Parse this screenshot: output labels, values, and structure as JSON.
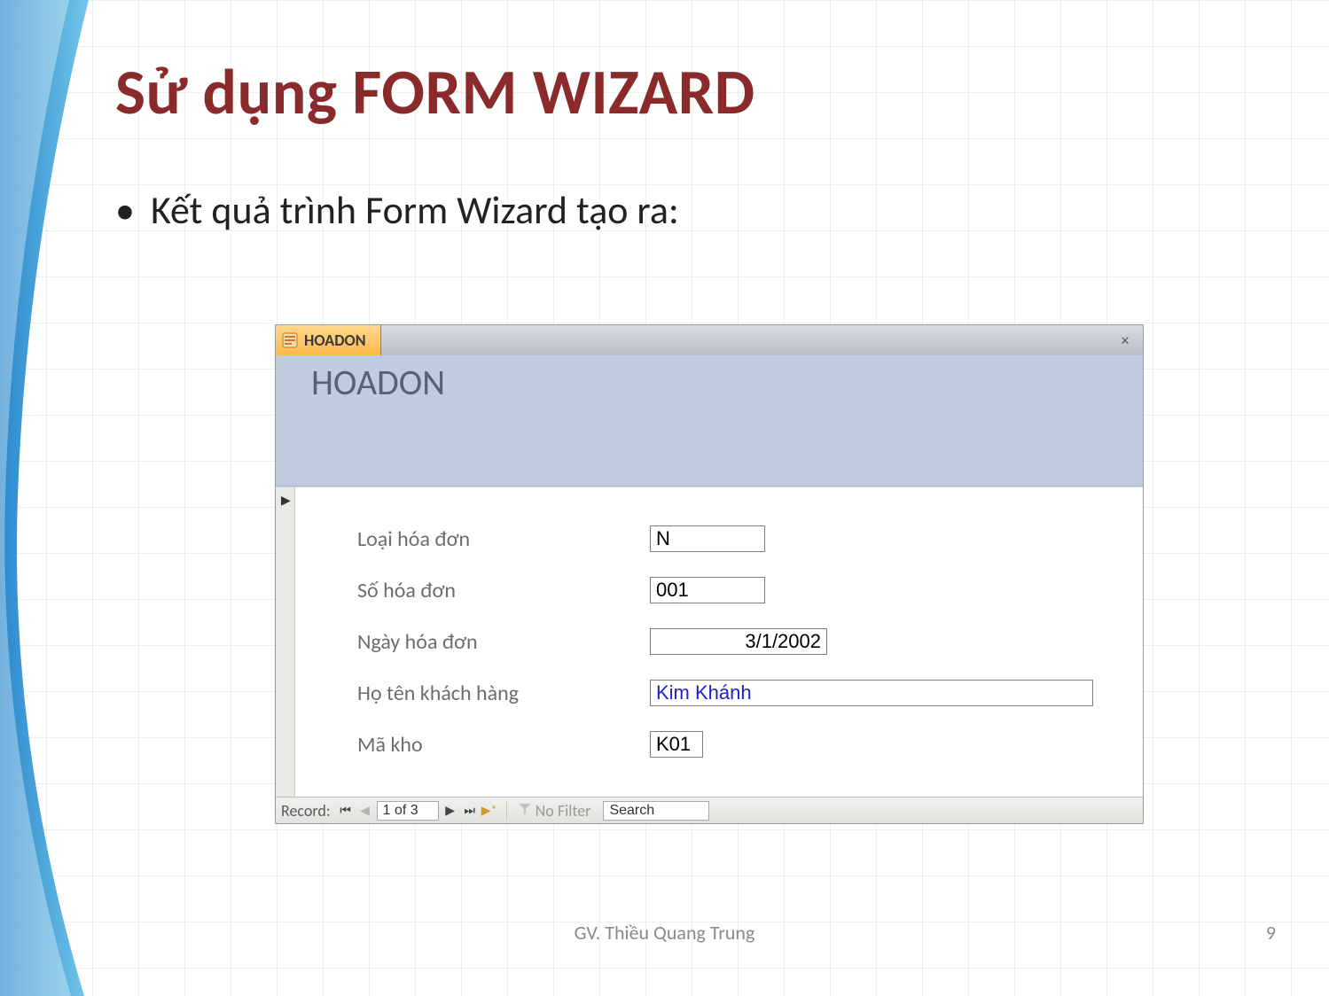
{
  "slide": {
    "title": "Sử dụng FORM WIZARD",
    "bullet": "Kết quả trình Form Wizard tạo ra:",
    "author": "GV. Thiều Quang Trung",
    "page": "9"
  },
  "access": {
    "tab_label": "HOADON",
    "header_title": "HOADON",
    "fields": {
      "loai_hd": {
        "label": "Loại hóa đơn",
        "value": "N"
      },
      "so_hd": {
        "label": "Số hóa đơn",
        "value": "001"
      },
      "ngay_hd": {
        "label": "Ngày hóa đơn",
        "value": "3/1/2002"
      },
      "hoten_kh": {
        "label": "Họ tên khách hàng",
        "value": "Kim Khánh"
      },
      "ma_kho": {
        "label": "Mã kho",
        "value": "K01"
      }
    },
    "nav": {
      "record_label": "Record:",
      "counter": "1 of 3",
      "filter_text": "No Filter",
      "search_value": "Search"
    }
  }
}
